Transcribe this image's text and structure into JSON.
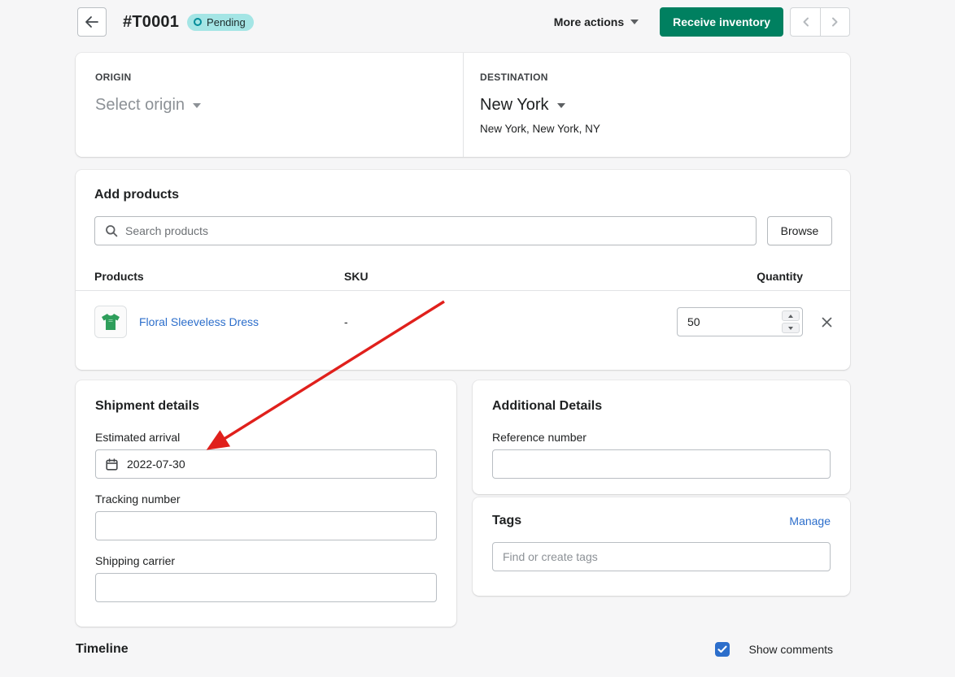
{
  "header": {
    "title": "#T0001",
    "status_badge": "Pending",
    "more_actions_label": "More actions",
    "receive_inventory_label": "Receive inventory"
  },
  "origin": {
    "label": "ORIGIN",
    "value": "Select origin"
  },
  "destination": {
    "label": "DESTINATION",
    "value": "New York",
    "subtitle": "New York, New York, NY"
  },
  "add_products": {
    "title": "Add products",
    "search_placeholder": "Search products",
    "browse_label": "Browse",
    "table": {
      "headers": {
        "products": "Products",
        "sku": "SKU",
        "quantity": "Quantity"
      },
      "rows": [
        {
          "product": "Floral Sleeveless Dress",
          "sku": "-",
          "quantity": "50"
        }
      ]
    }
  },
  "shipment_details": {
    "title": "Shipment details",
    "estimated_arrival_label": "Estimated arrival",
    "estimated_arrival_value": "2022-07-30",
    "tracking_number_label": "Tracking number",
    "tracking_number_value": "",
    "shipping_carrier_label": "Shipping carrier",
    "shipping_carrier_value": ""
  },
  "additional_details": {
    "title": "Additional Details",
    "reference_number_label": "Reference number",
    "reference_number_value": ""
  },
  "tags": {
    "title": "Tags",
    "manage_label": "Manage",
    "input_placeholder": "Find or create tags"
  },
  "timeline": {
    "title": "Timeline",
    "show_comments_label": "Show comments",
    "show_comments_checked": true
  },
  "icons": {
    "back": "arrow-left-icon",
    "badge_status": "ring-icon",
    "more_actions": "caret-down-icon",
    "pager_prev": "chevron-left-icon",
    "pager_next": "chevron-right-icon",
    "search": "magnifier-icon",
    "product_thumbnail": "tshirt-icon",
    "quantity_increment": "triangle-up-icon",
    "quantity_decrement": "triangle-down-icon",
    "remove_row": "x-icon",
    "estimated_arrival": "calendar-icon",
    "show_comments": "checkmark-icon",
    "annotation": "red-arrow"
  },
  "colors": {
    "page_bg": "#f6f6f7",
    "primary_green": "#008060",
    "badge_bg": "#a4e5e5",
    "badge_ring": "#008c99",
    "link_blue": "#2c6ecb",
    "checkbox_blue": "#2c6ecb",
    "annotation_red": "#e0201c",
    "thumbnail_green": "#2e9e5b"
  }
}
